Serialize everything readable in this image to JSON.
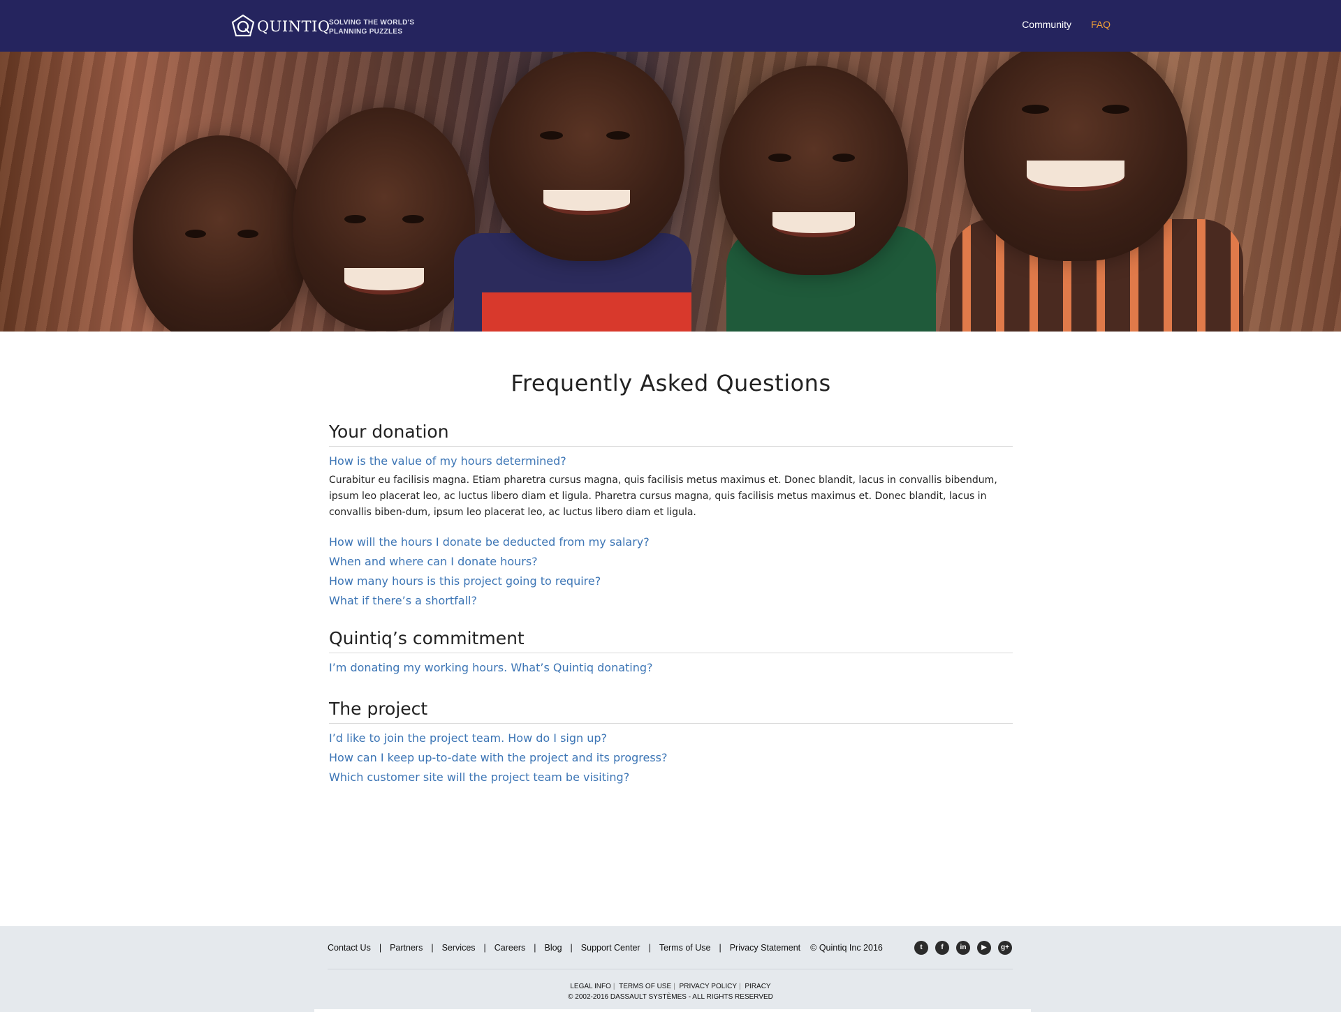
{
  "header": {
    "logo_text": "QUINTIQ",
    "tagline_line1": "SOLVING THE WORLD'S",
    "tagline_line2": "PLANNING PUZZLES",
    "nav": [
      {
        "label": "Community",
        "color": "#ffffff"
      },
      {
        "label": "FAQ",
        "color": "#f2a036",
        "active": true
      }
    ],
    "background": "#25245e"
  },
  "hero": {
    "image_description_icon": "hero-photo"
  },
  "main": {
    "title": "Frequently Asked Questions",
    "sections": [
      {
        "title": "Your donation",
        "questions": [
          {
            "q": "How is the value of my hours determined?",
            "answer": "Curabitur eu facilisis magna. Etiam pharetra cursus magna, quis facilisis metus maximus et. Donec blandit, lacus in convallis bibendum, ipsum leo placerat leo, ac luctus libero diam et ligula. Pharetra cursus magna, quis facilisis metus maximus et. Donec blandit, lacus in convallis biben-dum, ipsum leo placerat leo, ac luctus libero diam et ligula."
          },
          {
            "q": "How will the hours I donate be deducted from my salary?"
          },
          {
            "q": "When and where can I donate hours?"
          },
          {
            "q": "How many hours is this project going to require?"
          },
          {
            "q": "What if there’s a shortfall?"
          }
        ]
      },
      {
        "title": "Quintiq’s commitment",
        "questions": [
          {
            "q": "I’m donating my working hours. What’s Quintiq donating?"
          }
        ]
      },
      {
        "title": "The project",
        "questions": [
          {
            "q": "I’d like to join the project team. How do I sign up?"
          },
          {
            "q": "How can I keep up-to-date with the project and its progress?"
          },
          {
            "q": "Which customer site will the project team be visiting?"
          }
        ]
      }
    ],
    "link_color": "#3c75b5"
  },
  "footer": {
    "links": [
      "Contact Us",
      "Partners",
      "Services",
      "Careers",
      "Blog",
      "Support Center",
      "Terms of Use",
      "Privacy Statement"
    ],
    "copyright": "© Quintiq Inc 2016",
    "social": [
      {
        "name": "twitter-icon",
        "glyph": "t"
      },
      {
        "name": "facebook-icon",
        "glyph": "f"
      },
      {
        "name": "linkedin-icon",
        "glyph": "in"
      },
      {
        "name": "youtube-icon",
        "glyph": "▶"
      },
      {
        "name": "googleplus-icon",
        "glyph": "g+"
      }
    ],
    "legal_links": [
      "LEGAL INFO",
      "TERMS OF USE",
      "PRIVACY POLICY",
      "PIRACY"
    ],
    "legal_copyright": "© 2002-2016 DASSAULT SYSTÈMES - ALL RIGHTS RESERVED",
    "background": "#e5e9ed"
  }
}
